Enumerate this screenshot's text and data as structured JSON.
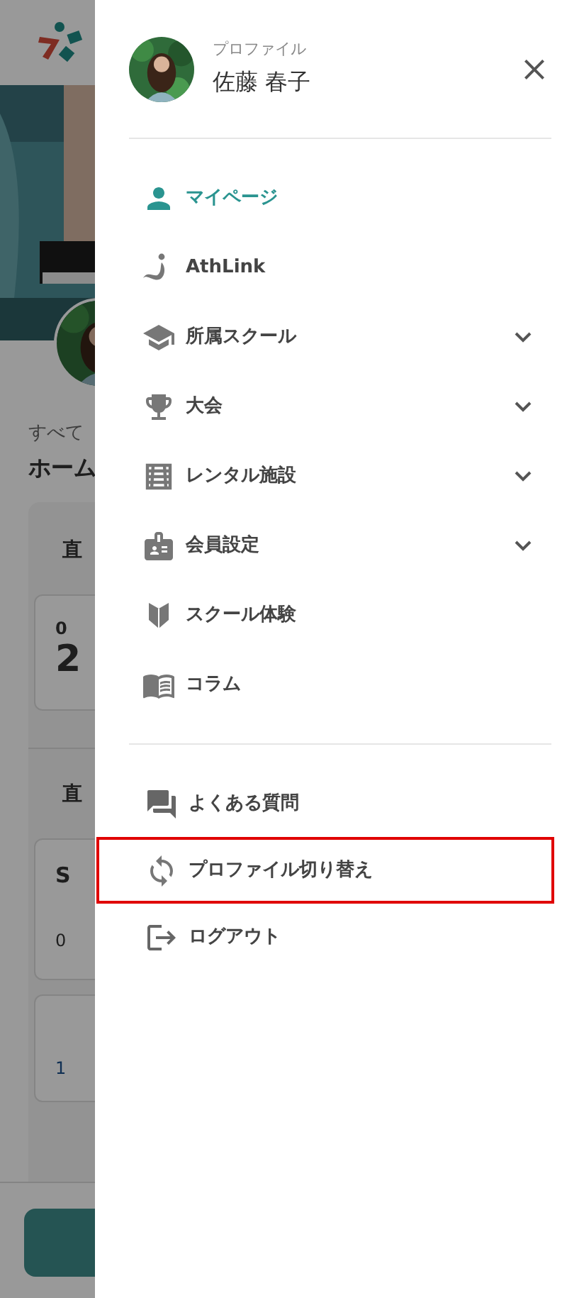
{
  "background_page": {
    "section_label": "すべて",
    "page_title": "ホーム",
    "card_1": {
      "heading": "直",
      "date": "0",
      "day": "2"
    },
    "card_2": {
      "heading": "直",
      "item_1": {
        "title": "S",
        "date": "0"
      },
      "item_2": {
        "date": "1"
      }
    }
  },
  "drawer": {
    "profile": {
      "caption": "プロファイル",
      "name": "佐藤 春子"
    },
    "main_menu": [
      {
        "label": "マイページ",
        "selected": true,
        "expandable": false
      },
      {
        "label": "AthLink",
        "selected": false,
        "expandable": false
      },
      {
        "label": "所属スクール",
        "selected": false,
        "expandable": true
      },
      {
        "label": "大会",
        "selected": false,
        "expandable": true
      },
      {
        "label": "レンタル施設",
        "selected": false,
        "expandable": true
      },
      {
        "label": "会員設定",
        "selected": false,
        "expandable": true
      },
      {
        "label": "スクール体験",
        "selected": false,
        "expandable": false
      },
      {
        "label": "コラム",
        "selected": false,
        "expandable": false
      }
    ],
    "secondary_menu": [
      {
        "label": "よくある質問",
        "highlighted": false
      },
      {
        "label": "プロファイル切り替え",
        "highlighted": true
      },
      {
        "label": "ログアウト",
        "highlighted": false
      }
    ]
  }
}
